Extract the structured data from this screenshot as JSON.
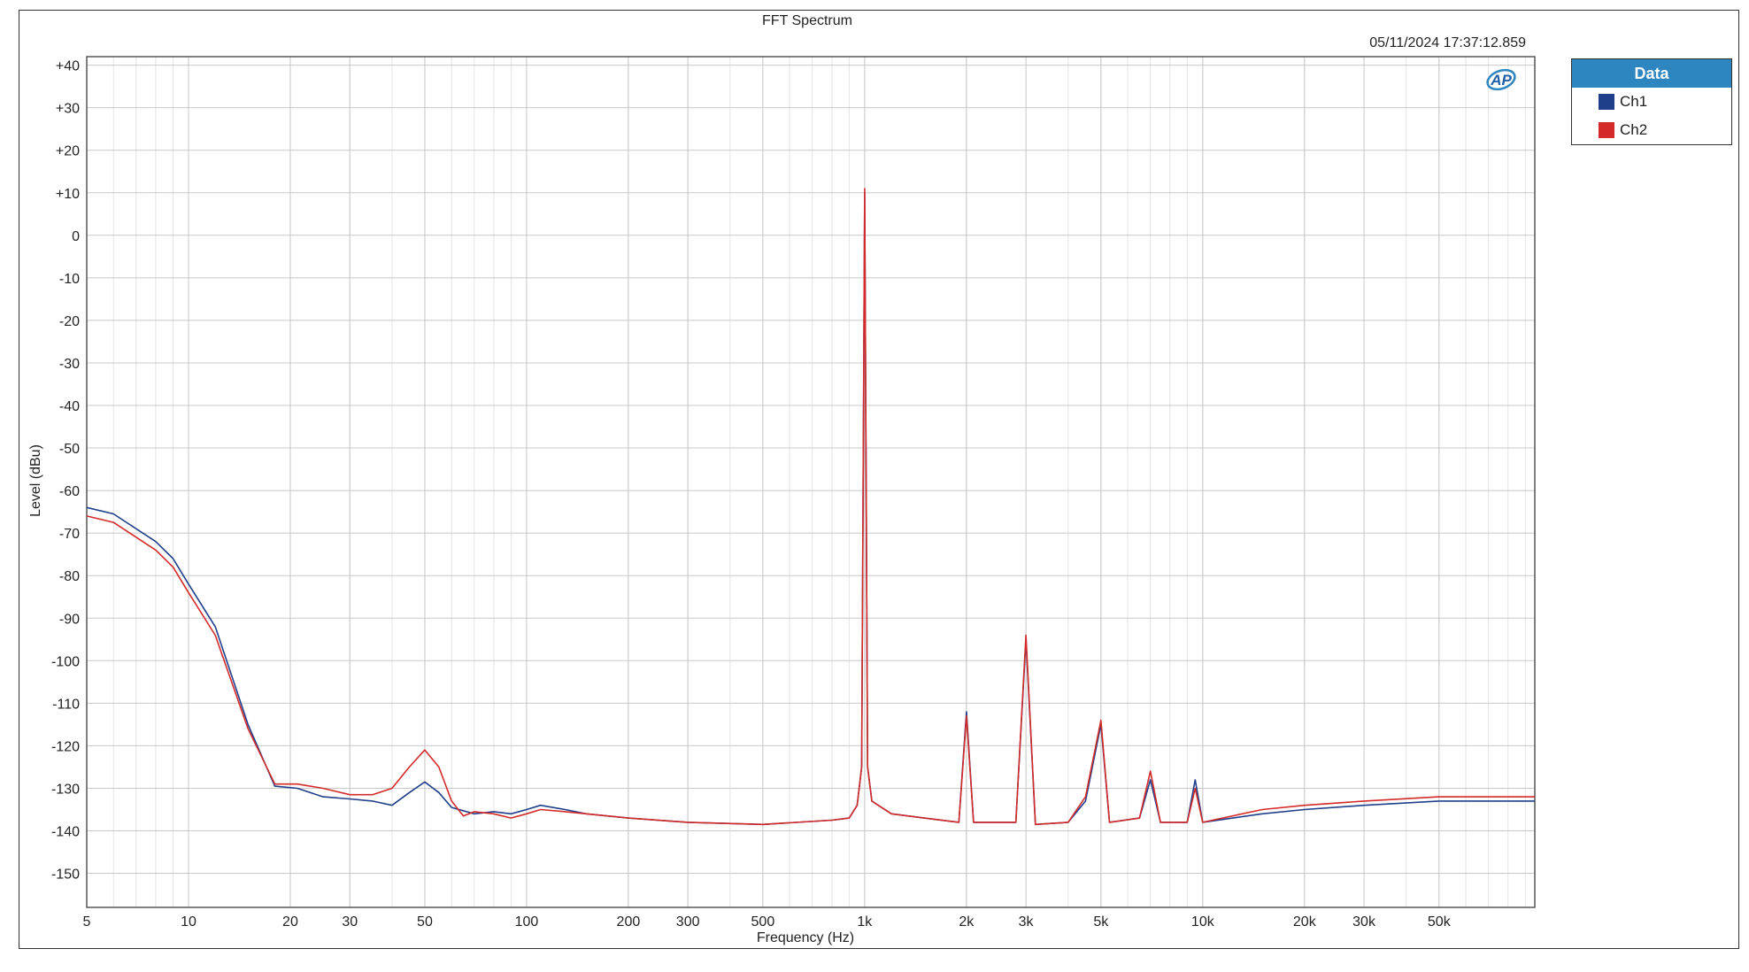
{
  "chart_data": {
    "type": "line",
    "title": "FFT Spectrum",
    "timestamp": "05/11/2024 17:37:12.859",
    "xlabel": "Frequency (Hz)",
    "ylabel": "Level (dBu)",
    "xscale": "log",
    "xlim": [
      5,
      96000
    ],
    "ylim": [
      -158,
      42
    ],
    "grid": true,
    "logo": "AP",
    "legend": {
      "title": "Data",
      "placement": "outside-right"
    },
    "x_ticks": [
      {
        "v": 5,
        "label": "5"
      },
      {
        "v": 10,
        "label": "10"
      },
      {
        "v": 20,
        "label": "20"
      },
      {
        "v": 30,
        "label": "30"
      },
      {
        "v": 50,
        "label": "50"
      },
      {
        "v": 100,
        "label": "100"
      },
      {
        "v": 200,
        "label": "200"
      },
      {
        "v": 300,
        "label": "300"
      },
      {
        "v": 500,
        "label": "500"
      },
      {
        "v": 1000,
        "label": "1k"
      },
      {
        "v": 2000,
        "label": "2k"
      },
      {
        "v": 3000,
        "label": "3k"
      },
      {
        "v": 5000,
        "label": "5k"
      },
      {
        "v": 10000,
        "label": "10k"
      },
      {
        "v": 20000,
        "label": "20k"
      },
      {
        "v": 30000,
        "label": "30k"
      },
      {
        "v": 50000,
        "label": "50k"
      }
    ],
    "y_ticks": [
      {
        "v": 40,
        "label": "+40"
      },
      {
        "v": 30,
        "label": "+30"
      },
      {
        "v": 20,
        "label": "+20"
      },
      {
        "v": 10,
        "label": "+10"
      },
      {
        "v": 0,
        "label": "0"
      },
      {
        "v": -10,
        "label": "-10"
      },
      {
        "v": -20,
        "label": "-20"
      },
      {
        "v": -30,
        "label": "-30"
      },
      {
        "v": -40,
        "label": "-40"
      },
      {
        "v": -50,
        "label": "-50"
      },
      {
        "v": -60,
        "label": "-60"
      },
      {
        "v": -70,
        "label": "-70"
      },
      {
        "v": -80,
        "label": "-80"
      },
      {
        "v": -90,
        "label": "-90"
      },
      {
        "v": -100,
        "label": "-100"
      },
      {
        "v": -110,
        "label": "-110"
      },
      {
        "v": -120,
        "label": "-120"
      },
      {
        "v": -130,
        "label": "-130"
      },
      {
        "v": -140,
        "label": "-140"
      },
      {
        "v": -150,
        "label": "-150"
      }
    ],
    "series": [
      {
        "name": "Ch1",
        "color": "#1f3f8a",
        "points": [
          [
            5,
            -64
          ],
          [
            6,
            -65.5
          ],
          [
            8,
            -72
          ],
          [
            9,
            -76
          ],
          [
            10,
            -82
          ],
          [
            12,
            -92
          ],
          [
            15,
            -115
          ],
          [
            18,
            -129.5
          ],
          [
            21,
            -130
          ],
          [
            25,
            -132
          ],
          [
            30,
            -132.5
          ],
          [
            35,
            -133
          ],
          [
            40,
            -134
          ],
          [
            45,
            -131
          ],
          [
            50,
            -128.5
          ],
          [
            55,
            -131
          ],
          [
            60,
            -134.5
          ],
          [
            70,
            -136
          ],
          [
            80,
            -135.5
          ],
          [
            90,
            -136
          ],
          [
            100,
            -135
          ],
          [
            110,
            -134
          ],
          [
            130,
            -135
          ],
          [
            150,
            -136
          ],
          [
            200,
            -137
          ],
          [
            300,
            -138
          ],
          [
            500,
            -138.5
          ],
          [
            800,
            -137.5
          ],
          [
            900,
            -137
          ],
          [
            950,
            -134
          ],
          [
            980,
            -125
          ],
          [
            1000,
            10
          ],
          [
            1020,
            -125
          ],
          [
            1050,
            -133
          ],
          [
            1200,
            -136
          ],
          [
            1500,
            -137
          ],
          [
            1900,
            -138
          ],
          [
            2000,
            -112
          ],
          [
            2100,
            -138
          ],
          [
            2800,
            -138
          ],
          [
            3000,
            -95
          ],
          [
            3200,
            -138.5
          ],
          [
            4000,
            -138
          ],
          [
            4500,
            -133
          ],
          [
            5000,
            -115
          ],
          [
            5300,
            -138
          ],
          [
            6500,
            -137
          ],
          [
            7000,
            -128
          ],
          [
            7500,
            -138
          ],
          [
            9000,
            -138
          ],
          [
            9500,
            -128
          ],
          [
            10000,
            -138
          ],
          [
            15000,
            -136
          ],
          [
            20000,
            -135
          ],
          [
            30000,
            -134
          ],
          [
            50000,
            -133
          ],
          [
            70000,
            -133
          ],
          [
            96000,
            -133
          ]
        ]
      },
      {
        "name": "Ch2",
        "color": "#d42a2a",
        "points": [
          [
            5,
            -66
          ],
          [
            6,
            -67.5
          ],
          [
            8,
            -74
          ],
          [
            9,
            -78
          ],
          [
            10,
            -84
          ],
          [
            12,
            -94
          ],
          [
            15,
            -116
          ],
          [
            18,
            -129
          ],
          [
            21,
            -129
          ],
          [
            25,
            -130
          ],
          [
            30,
            -131.5
          ],
          [
            35,
            -131.5
          ],
          [
            40,
            -130
          ],
          [
            45,
            -125
          ],
          [
            50,
            -121
          ],
          [
            55,
            -125
          ],
          [
            60,
            -133
          ],
          [
            65,
            -136.5
          ],
          [
            70,
            -135.5
          ],
          [
            80,
            -136
          ],
          [
            90,
            -137
          ],
          [
            100,
            -136
          ],
          [
            110,
            -135
          ],
          [
            130,
            -135.5
          ],
          [
            150,
            -136
          ],
          [
            200,
            -137
          ],
          [
            300,
            -138
          ],
          [
            500,
            -138.5
          ],
          [
            800,
            -137.5
          ],
          [
            900,
            -137
          ],
          [
            950,
            -134
          ],
          [
            980,
            -125
          ],
          [
            1000,
            11
          ],
          [
            1020,
            -125
          ],
          [
            1050,
            -133
          ],
          [
            1200,
            -136
          ],
          [
            1500,
            -137
          ],
          [
            1900,
            -138
          ],
          [
            2000,
            -113
          ],
          [
            2100,
            -138
          ],
          [
            2800,
            -138
          ],
          [
            3000,
            -94
          ],
          [
            3200,
            -138.5
          ],
          [
            4000,
            -138
          ],
          [
            4500,
            -132
          ],
          [
            5000,
            -114
          ],
          [
            5300,
            -138
          ],
          [
            6500,
            -137
          ],
          [
            7000,
            -126
          ],
          [
            7500,
            -138
          ],
          [
            9000,
            -138
          ],
          [
            9500,
            -130
          ],
          [
            10000,
            -138
          ],
          [
            15000,
            -135
          ],
          [
            20000,
            -134
          ],
          [
            30000,
            -133
          ],
          [
            50000,
            -132
          ],
          [
            70000,
            -132
          ],
          [
            96000,
            -132
          ]
        ]
      }
    ]
  }
}
